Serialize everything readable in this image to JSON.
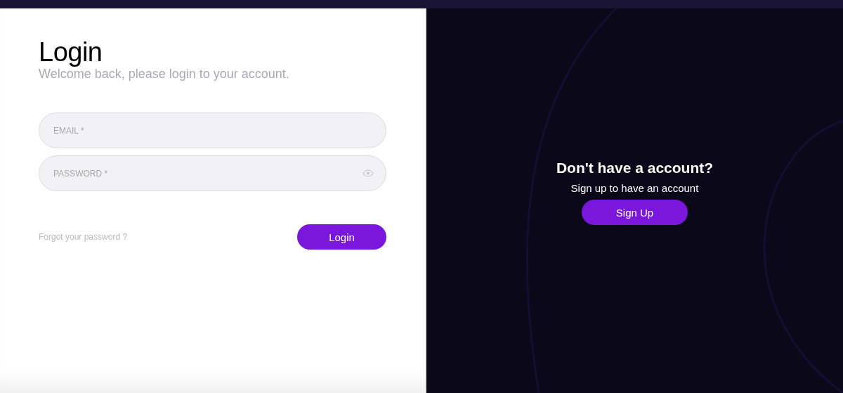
{
  "login": {
    "title": "Login",
    "subtitle": "Welcome back, please login to your account.",
    "fields": [
      {
        "kind": "email",
        "placeholder": "EMAIL *"
      },
      {
        "kind": "password",
        "placeholder": "PASSWORD *"
      }
    ],
    "forgot_link": "Forgot your password ?",
    "button": "Login"
  },
  "signup": {
    "title": "Don't have a account?",
    "text": "Sign up to have an account",
    "button": "Sign Up"
  }
}
